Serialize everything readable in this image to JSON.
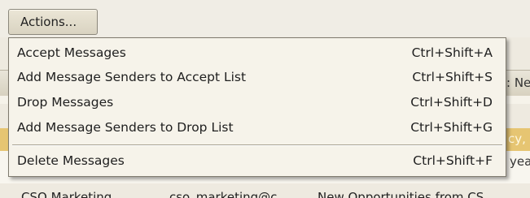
{
  "toolbar": {
    "actions_label": "Actions..."
  },
  "menu": {
    "items": [
      {
        "label": "Accept Messages",
        "shortcut": "Ctrl+Shift+A"
      },
      {
        "label": "Add Message Senders to Accept List",
        "shortcut": "Ctrl+Shift+S"
      },
      {
        "label": "Drop Messages",
        "shortcut": "Ctrl+Shift+D"
      },
      {
        "label": "Add Message Senders to Drop List",
        "shortcut": "Ctrl+Shift+G"
      },
      {
        "label": "Delete Messages",
        "shortcut": "Ctrl+Shift+F"
      }
    ]
  },
  "background": {
    "header_fragment": ": Ne",
    "selected_fragment": "cy,",
    "row_fragment": "yea",
    "bottom_row": {
      "sender": "CSO Marketing",
      "email": "cso_marketing@c",
      "subject": "New Opportunities from CS"
    }
  },
  "colors": {
    "menu_bg": "#f6f3ea",
    "selected_row": "#e6c572",
    "border": "#7f7a6e"
  }
}
